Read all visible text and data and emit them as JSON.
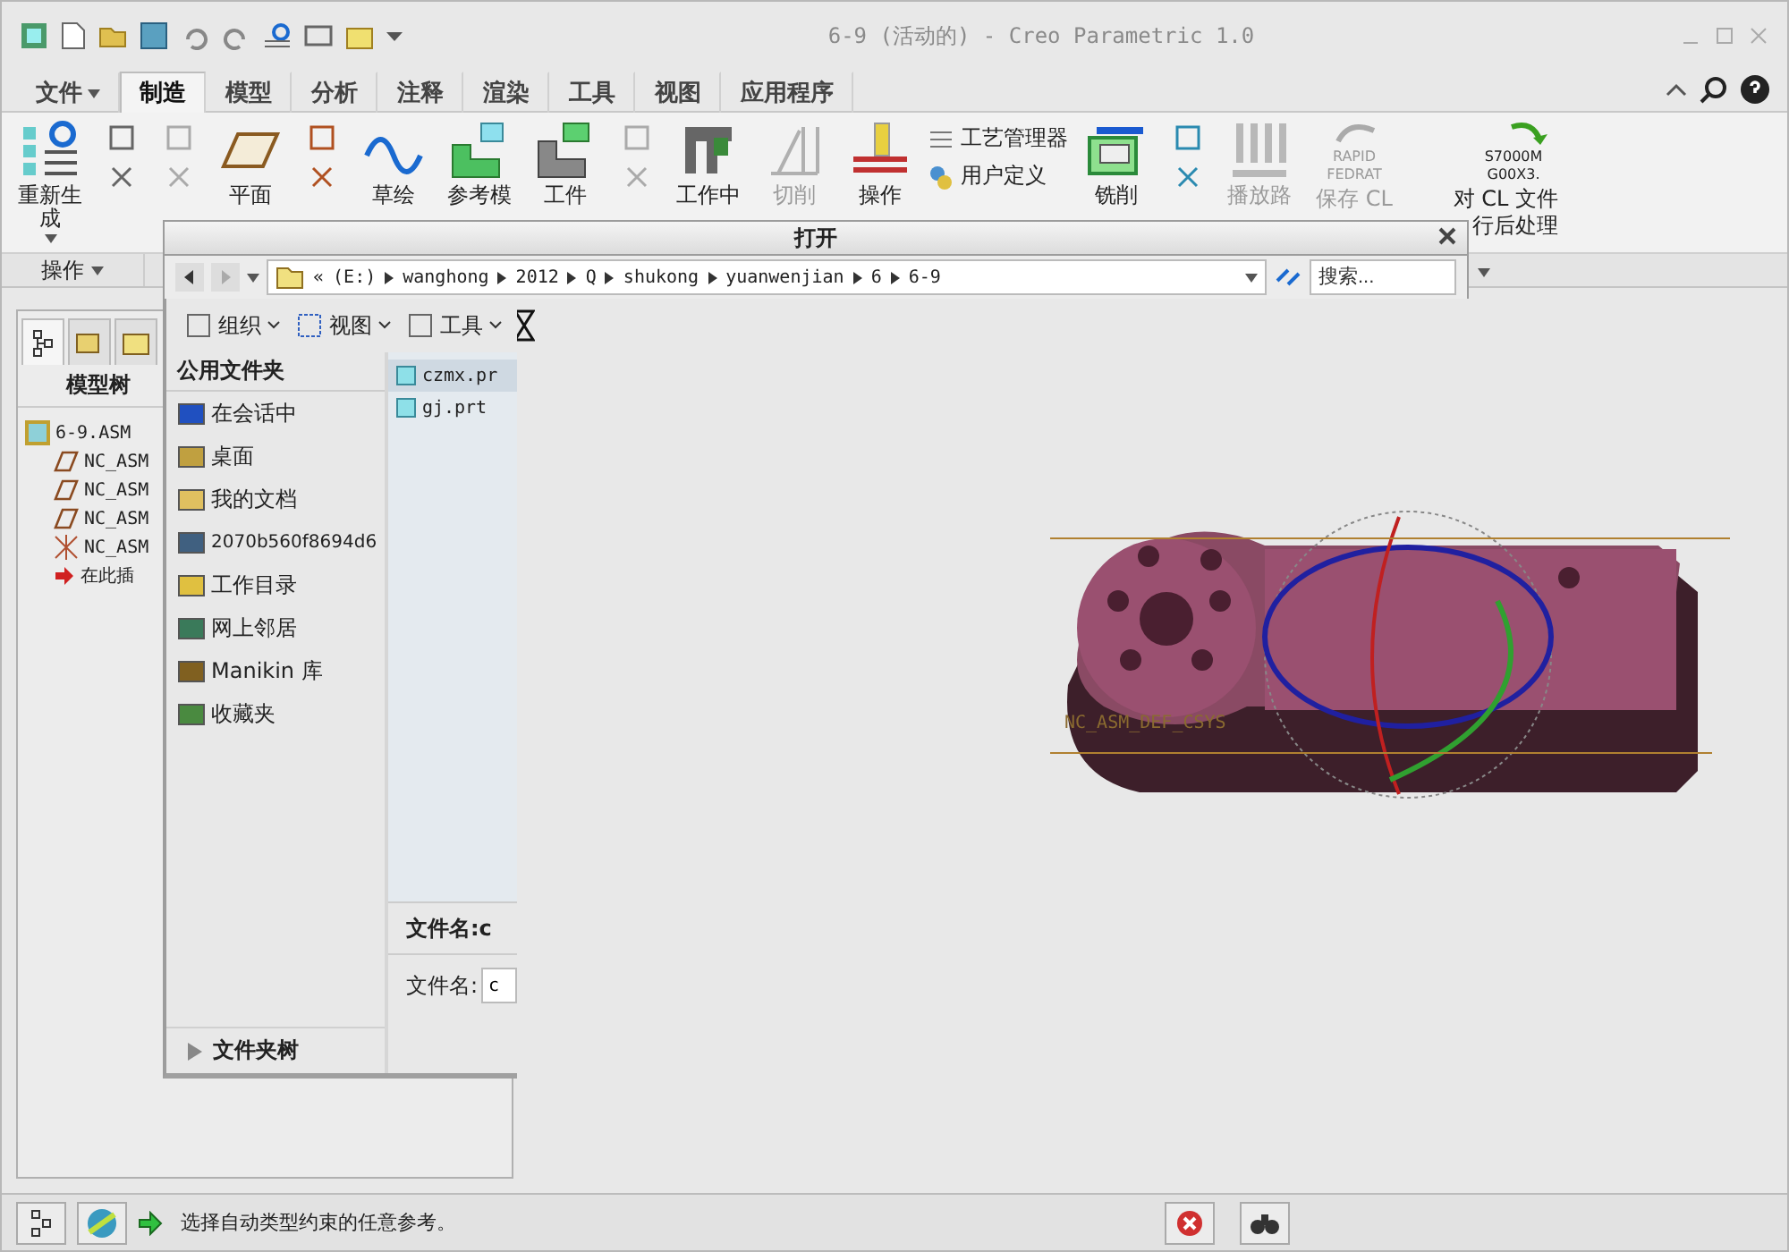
{
  "window": {
    "title": "6-9 (活动的) - Creo Parametric 1.0"
  },
  "tabs": [
    {
      "label": "文件",
      "selected": false,
      "kind": "menu"
    },
    {
      "label": "制造",
      "selected": true,
      "kind": "tab"
    },
    {
      "label": "模型",
      "selected": false,
      "kind": "tab"
    },
    {
      "label": "分析",
      "selected": false,
      "kind": "tab"
    },
    {
      "label": "注释",
      "selected": false,
      "kind": "tab"
    },
    {
      "label": "渲染",
      "selected": false,
      "kind": "tab"
    },
    {
      "label": "工具",
      "selected": false,
      "kind": "tab"
    },
    {
      "label": "视图",
      "selected": false,
      "kind": "tab"
    },
    {
      "label": "应用程序",
      "selected": false,
      "kind": "tab"
    }
  ],
  "ribbon": [
    {
      "kind": "large",
      "label": "重新生成",
      "disabled": false,
      "dropdown": true
    },
    {
      "kind": "tools"
    },
    {
      "kind": "tools"
    },
    {
      "kind": "large",
      "label": "平面",
      "disabled": false
    },
    {
      "kind": "tools"
    },
    {
      "kind": "large",
      "label": "草绘",
      "disabled": false
    },
    {
      "kind": "large",
      "label": "参考模",
      "disabled": false
    },
    {
      "kind": "large",
      "label": "工件",
      "disabled": false
    },
    {
      "kind": "tools"
    },
    {
      "kind": "large",
      "label": "工作中",
      "disabled": false
    },
    {
      "kind": "large",
      "label": "切削",
      "disabled": true
    },
    {
      "kind": "large",
      "label": "操作",
      "disabled": false
    },
    {
      "kind": "small",
      "items": [
        {
          "label": "工艺管理器"
        },
        {
          "label": "用户定义"
        }
      ]
    },
    {
      "kind": "large",
      "label": "铣削",
      "disabled": false
    },
    {
      "kind": "tools"
    },
    {
      "kind": "large",
      "label": "播放路",
      "disabled": true
    },
    {
      "kind": "large",
      "label": "保存 CL",
      "icon_text": "RAPID FEDRAT",
      "disabled": true
    },
    {
      "kind": "large",
      "label": "对 CL 文件",
      "label_2": "行后处理",
      "icon_text": "S7000M G00X3.",
      "disabled": false
    }
  ],
  "ribbon_groups": [
    {
      "label": "操作"
    }
  ],
  "model_tree": {
    "title": "模型树",
    "items": [
      {
        "label": "6-9.ASM",
        "kind": "assembly",
        "children": [
          {
            "label": "NC_ASM",
            "kind": "plane"
          },
          {
            "label": "NC_ASM",
            "kind": "plane"
          },
          {
            "label": "NC_ASM",
            "kind": "plane"
          },
          {
            "label": "NC_ASM",
            "kind": "csys"
          },
          {
            "label": "在此插",
            "kind": "insert"
          }
        ]
      }
    ]
  },
  "dialog": {
    "title": "打开",
    "path": [
      "«",
      "(E:)",
      "wanghong",
      "2012",
      "Q",
      "shukong",
      "yuanwenjian",
      "6",
      "6-9"
    ],
    "search": {
      "placeholder": "搜索..."
    },
    "toolbar": [
      {
        "label": "组织"
      },
      {
        "label": "视图"
      },
      {
        "label": "工具"
      }
    ],
    "sidebar_title": "公用文件夹",
    "places": [
      {
        "label": "在会话中"
      },
      {
        "label": "桌面"
      },
      {
        "label": "我的文档"
      },
      {
        "label": "2070b560f8694d6"
      },
      {
        "label": "工作目录"
      },
      {
        "label": "网上邻居"
      },
      {
        "label": "Manikin 库"
      },
      {
        "label": "收藏夹"
      }
    ],
    "folder_tree": {
      "label": "文件夹树",
      "expanded": false
    },
    "files": [
      {
        "name": "czmx.pr",
        "selected": true
      },
      {
        "name": "gj.prt",
        "selected": false
      }
    ],
    "preview_name": "文件名:c",
    "name_field": {
      "label": "文件名:",
      "value": "c"
    }
  },
  "viewport": {
    "csys_label": "NC_ASM_DEF_CSYS"
  },
  "status_bar": {
    "message": "选择自动类型约束的任意参考。"
  }
}
